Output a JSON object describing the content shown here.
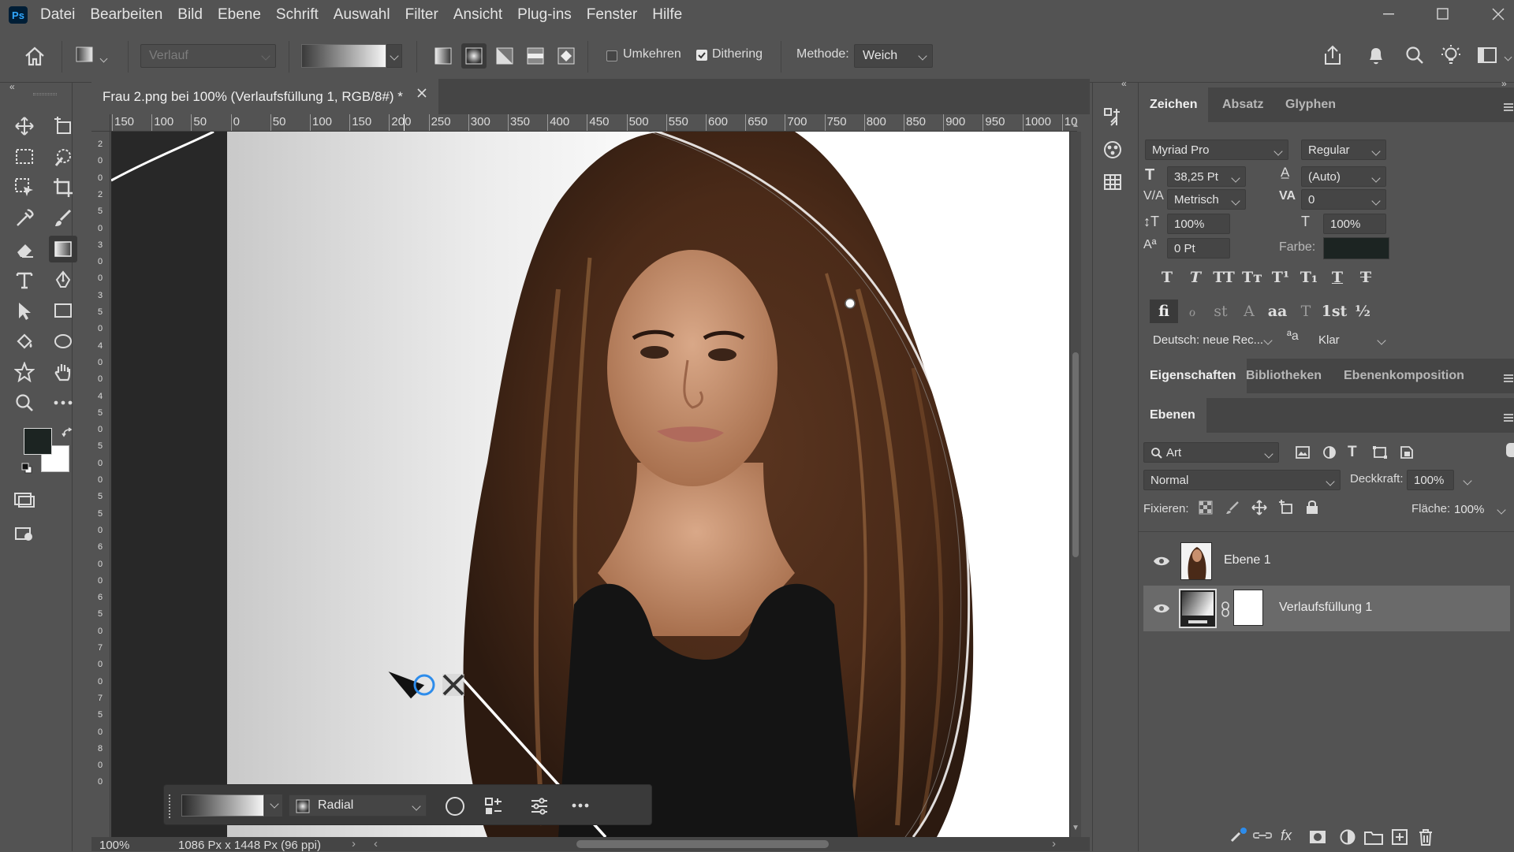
{
  "menubar": {
    "app_icon": "Ps",
    "items": [
      "Datei",
      "Bearbeiten",
      "Bild",
      "Ebene",
      "Schrift",
      "Auswahl",
      "Filter",
      "Ansicht",
      "Plug-ins",
      "Fenster",
      "Hilfe"
    ]
  },
  "options": {
    "preset_placeholder": "Verlauf",
    "umkehren_label": "Umkehren",
    "umkehren_checked": false,
    "dithering_label": "Dithering",
    "dithering_checked": true,
    "methode_label": "Methode:",
    "methode_value": "Weich"
  },
  "document": {
    "tab_title": "Frau 2.png bei 100% (Verlaufsfüllung 1, RGB/8#) *",
    "ruler_labels": [
      "150",
      "100",
      "50",
      "0",
      "50",
      "100",
      "150",
      "200",
      "250",
      "300",
      "350",
      "400",
      "450",
      "500",
      "550",
      "600",
      "650",
      "700",
      "750",
      "800",
      "850",
      "900",
      "950",
      "1000",
      "10"
    ],
    "vruler_labels": [
      "2",
      "0",
      "0",
      "2",
      "5",
      "0",
      "3",
      "0",
      "0",
      "3",
      "5",
      "0",
      "4",
      "0",
      "0",
      "4",
      "5",
      "0",
      "5",
      "0",
      "0",
      "5",
      "5",
      "0",
      "6",
      "0",
      "0",
      "6",
      "5",
      "0",
      "7",
      "0",
      "0",
      "7",
      "5",
      "0",
      "8",
      "0",
      "0"
    ]
  },
  "status": {
    "zoom": "100%",
    "size": "1086 Px x 1448 Px (96 ppi)"
  },
  "taskbar": {
    "gradient_type": "Radial"
  },
  "zeichen": {
    "tabs": [
      "Zeichen",
      "Absatz",
      "Glyphen"
    ],
    "font_family": "Myriad Pro",
    "font_style": "Regular",
    "font_size": "38,25 Pt",
    "leading": "(Auto)",
    "kerning": "Metrisch",
    "tracking": "0",
    "vscale": "100%",
    "hscale": "100%",
    "baseline": "0 Pt",
    "color_label": "Farbe:",
    "color_value": "#1c2422",
    "language": "Deutsch: neue Rec...",
    "antialias_label": "ªa",
    "antialias": "Klar",
    "style_glyphs": [
      "T",
      "T",
      "TT",
      "Tт",
      "T¹",
      "T₁",
      "T",
      "T"
    ],
    "ot_glyphs": [
      "fi",
      "ℴ",
      "st",
      "A",
      "aa",
      "T",
      "1st",
      "½"
    ]
  },
  "properties": {
    "tabs": [
      "Eigenschaften",
      "Bibliotheken",
      "Ebenenkomposition"
    ]
  },
  "layers": {
    "tab": "Ebenen",
    "filter": "Art",
    "blend_mode": "Normal",
    "opacity_label": "Deckkraft:",
    "opacity": "100%",
    "lock_label": "Fixieren:",
    "fill_label": "Fläche:",
    "fill": "100%",
    "items": [
      {
        "name": "Ebene 1",
        "selected": false
      },
      {
        "name": "Verlaufsfüllung 1",
        "selected": true
      }
    ]
  }
}
